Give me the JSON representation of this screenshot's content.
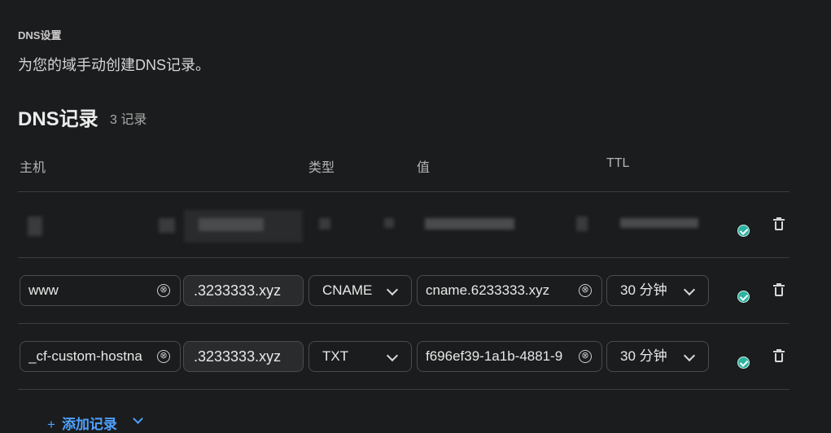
{
  "section_label": "DNS设置",
  "description": "为您的域手动创建DNS记录。",
  "records_title": "DNS记录",
  "records_count": "3 记录",
  "columns": {
    "host": "主机",
    "type": "类型",
    "value": "值",
    "ttl": "TTL"
  },
  "rows": [
    {
      "host": "www",
      "domain_suffix": ".3233333.xyz",
      "type": "CNAME",
      "value": "cname.6233333.xyz",
      "ttl": "30 分钟"
    },
    {
      "host": "_cf-custom-hostna",
      "domain_suffix": ".3233333.xyz",
      "type": "TXT",
      "value": "f696ef39-1a1b-4881-9",
      "ttl": "30 分钟"
    }
  ],
  "add_record_label": "添加记录",
  "add_icon": "+",
  "clear_icon": "⊗",
  "colors": {
    "background": "#1b1c1d",
    "accent": "#4ea1ff",
    "status_ok": "#2cb3a1"
  }
}
